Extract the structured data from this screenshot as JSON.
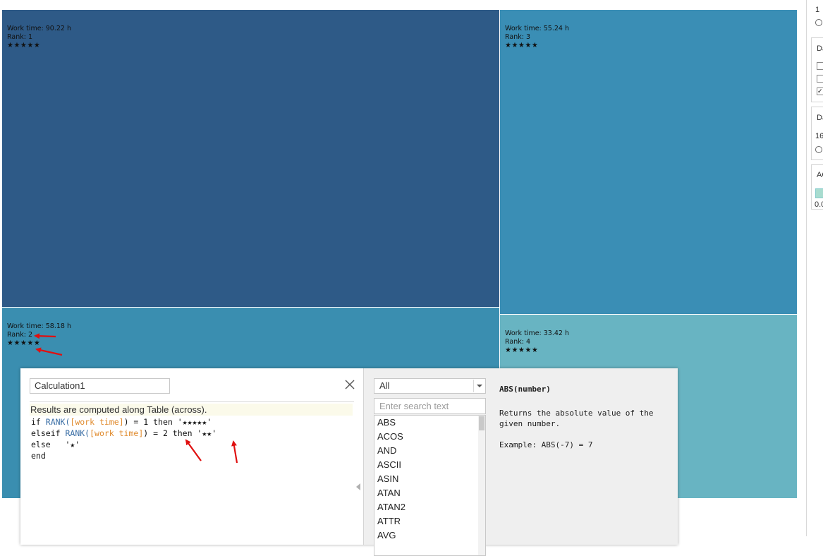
{
  "treemap": {
    "tiles": [
      {
        "work_time": "Work time: 90.22  h",
        "rank": "Rank: 1",
        "stars": "★★★★★",
        "color": "#2e5a87"
      },
      {
        "work_time": "Work time: 55.24  h",
        "rank": "Rank: 3",
        "stars": "★★★★★",
        "color": "#3a8eb5"
      },
      {
        "work_time": "Work time: 58.18  h",
        "rank": "Rank: 2",
        "stars": "★★★★★",
        "color": "#3a8eb0"
      },
      {
        "work_time": "Work time: 33.42  h",
        "rank": "Rank: 4",
        "stars": "★★★★★",
        "color": "#68b4c2"
      }
    ]
  },
  "right_panel": {
    "texts": [
      "1",
      "Da",
      "Da",
      "16",
      "AC",
      "0.0"
    ]
  },
  "calc_dialog": {
    "name_value": "Calculation1",
    "info": "Results are computed along Table (across).",
    "code": {
      "l1": {
        "kw": "if ",
        "fn": "RANK(",
        "field": "[work time]",
        "rest": ") = 1 then '★★★★★'"
      },
      "l2": {
        "kw": "elseif ",
        "fn": "RANK(",
        "field": "[work time]",
        "rest": ") = 2 then '★★'"
      },
      "l3": "else   '★'",
      "l4": "end"
    },
    "func_filter": "All",
    "search_placeholder": "Enter search text",
    "functions": [
      "ABS",
      "ACOS",
      "AND",
      "ASCII",
      "ASIN",
      "ATAN",
      "ATAN2",
      "ATTR",
      "AVG"
    ],
    "help": {
      "signature": "ABS(number)",
      "description": "Returns the absolute value of the given number.",
      "example": "Example: ABS(-7) = 7"
    }
  },
  "colors": {
    "annotation_arrow": "#e01010",
    "function_name": "#3a6ea5",
    "field_name": "#e08a2c"
  },
  "icons": [
    "close-icon",
    "chevron-down-icon",
    "collapse-left-icon",
    "checkbox-icon",
    "radio-icon"
  ]
}
